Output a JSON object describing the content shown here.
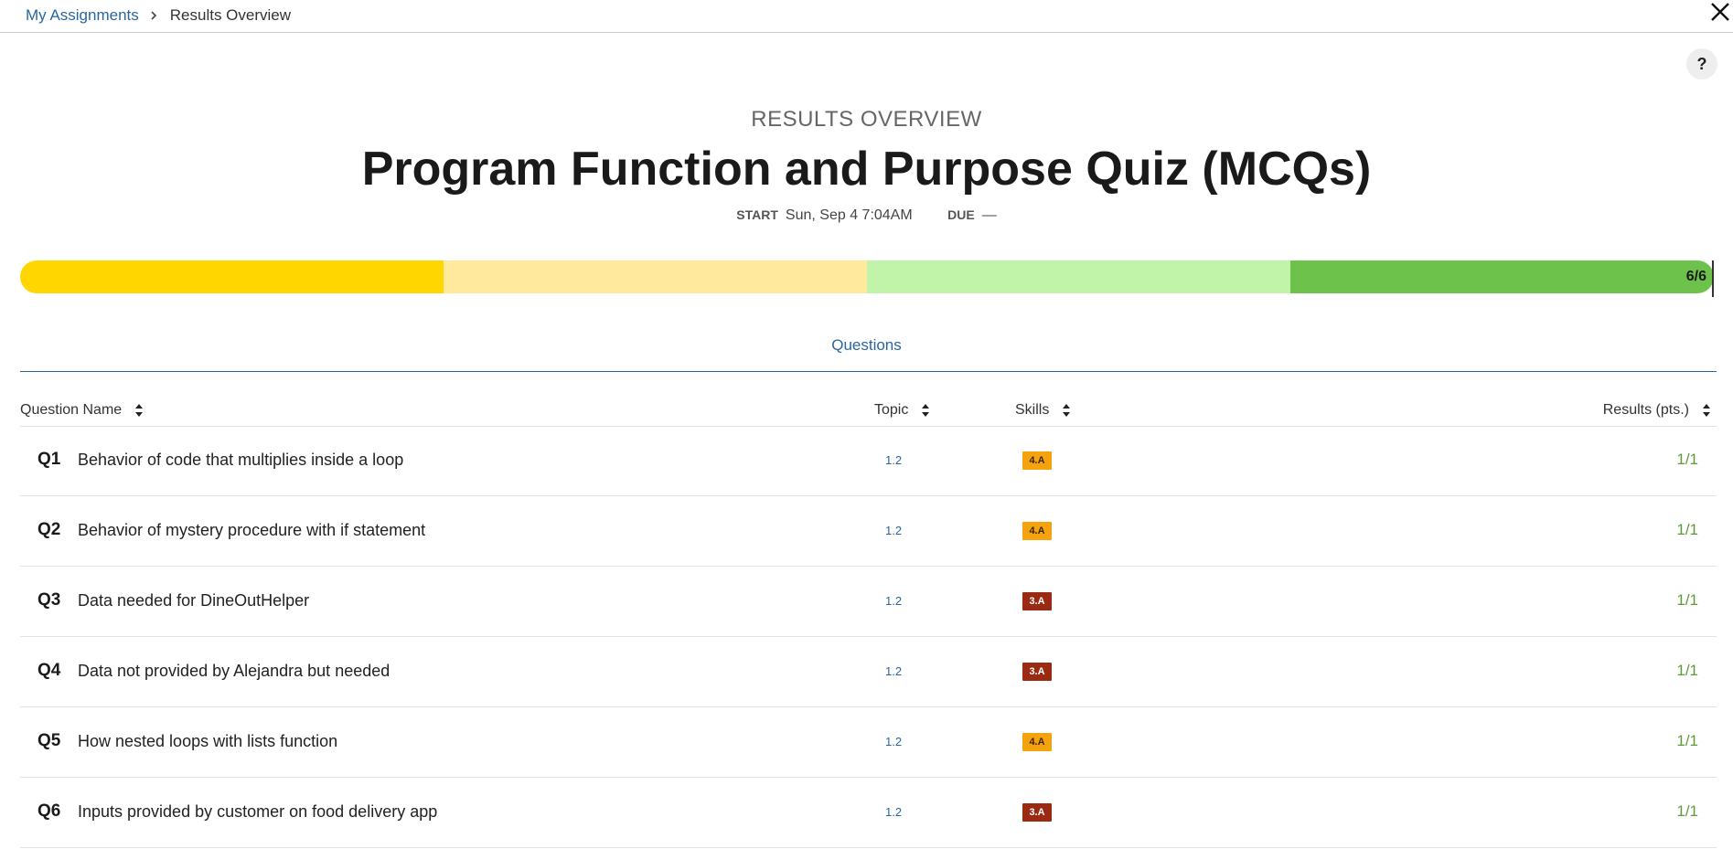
{
  "breadcrumb": {
    "parent": "My Assignments",
    "current": "Results Overview"
  },
  "help": {
    "label": "?"
  },
  "header": {
    "kicker": "RESULTS OVERVIEW",
    "title": "Program Function and Purpose Quiz (MCQs)",
    "start_label": "START",
    "start_value": "Sun, Sep 4 7:04AM",
    "due_label": "DUE",
    "due_value": "—"
  },
  "progress": {
    "label": "6/6",
    "score": 6,
    "total": 6,
    "segment_colors": [
      "#ffd600",
      "#ffe99c",
      "#c1f3a8",
      "#6cc24a"
    ]
  },
  "tabs": {
    "questions": "Questions"
  },
  "table": {
    "headers": {
      "name": "Question Name",
      "topic": "Topic",
      "skills": "Skills",
      "results": "Results (pts.)"
    },
    "rows": [
      {
        "num": "Q1",
        "name": "Behavior of code that multiplies inside a loop",
        "topic": "1.2",
        "skill": "4.A",
        "result": "1/1"
      },
      {
        "num": "Q2",
        "name": "Behavior of mystery procedure with if statement",
        "topic": "1.2",
        "skill": "4.A",
        "result": "1/1"
      },
      {
        "num": "Q3",
        "name": "Data needed for DineOutHelper",
        "topic": "1.2",
        "skill": "3.A",
        "result": "1/1"
      },
      {
        "num": "Q4",
        "name": "Data not provided by Alejandra but needed",
        "topic": "1.2",
        "skill": "3.A",
        "result": "1/1"
      },
      {
        "num": "Q5",
        "name": "How nested loops with lists function",
        "topic": "1.2",
        "skill": "4.A",
        "result": "1/1"
      },
      {
        "num": "Q6",
        "name": "Inputs provided by customer on food delivery app",
        "topic": "1.2",
        "skill": "3.A",
        "result": "1/1"
      }
    ]
  },
  "skill_colors": {
    "4.A": {
      "bg": "#f5a20f",
      "fg": "#3a2500"
    },
    "3.A": {
      "bg": "#9b2a12",
      "fg": "#ffffff"
    }
  },
  "result_color": "#5f9a3a"
}
